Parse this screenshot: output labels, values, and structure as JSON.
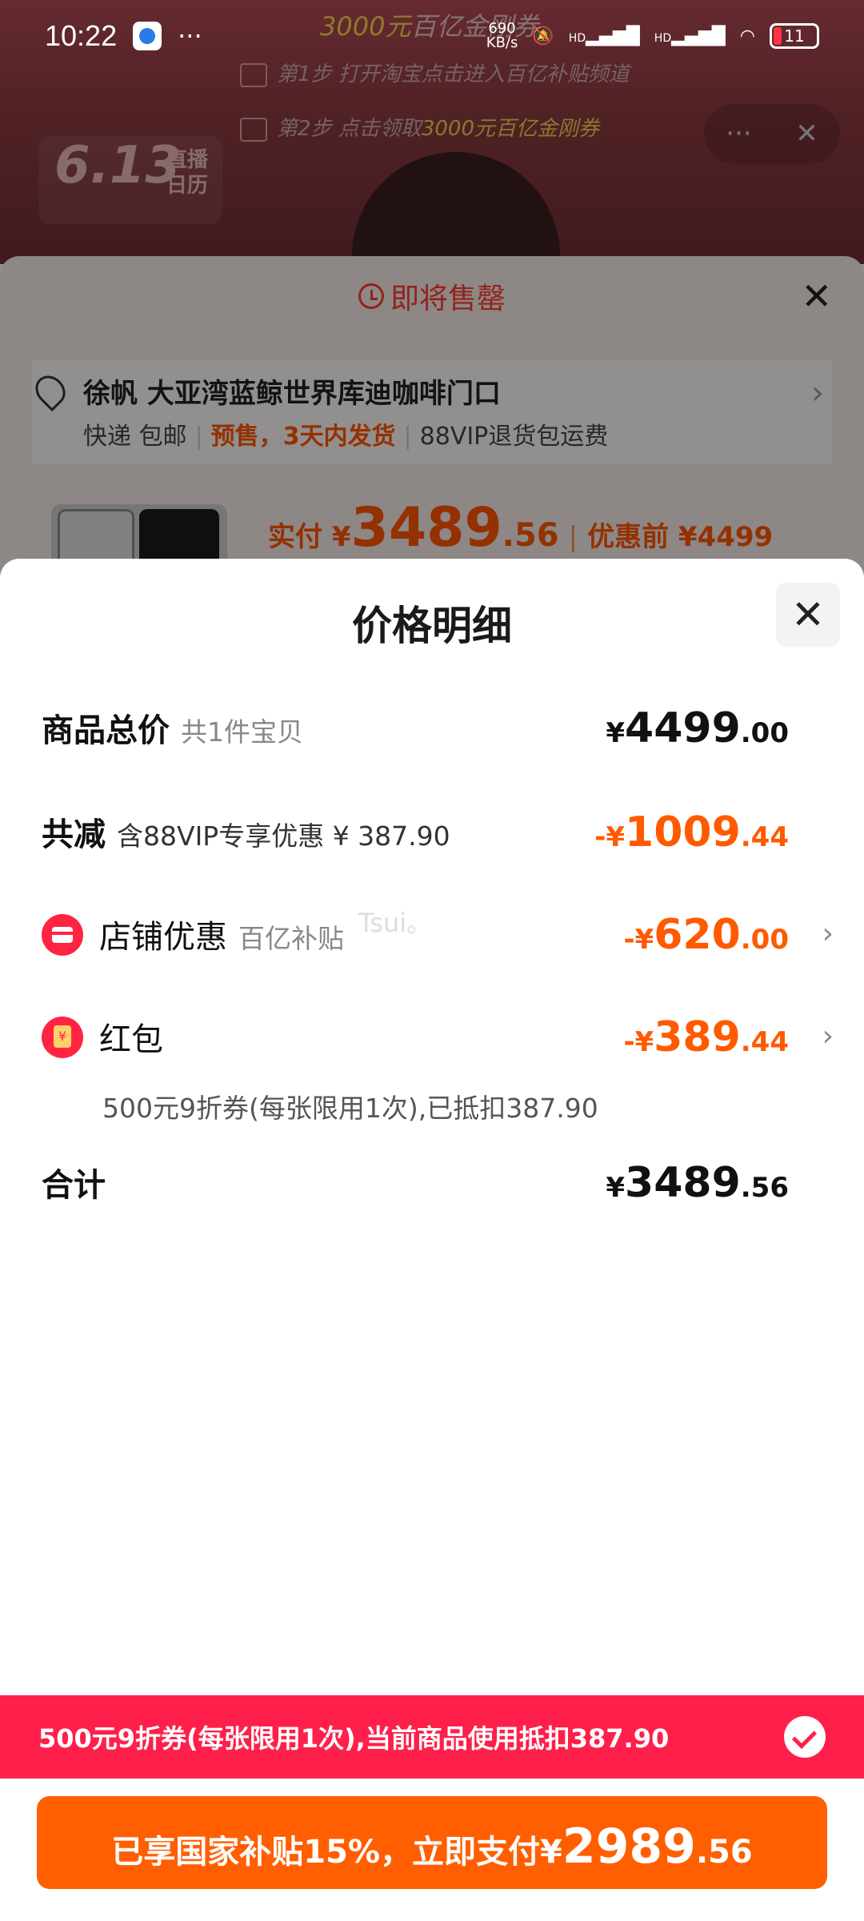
{
  "status_bar": {
    "time": "10:22",
    "dots": "···",
    "speed_value": "690",
    "speed_unit": "KB/s",
    "network": "HD",
    "battery": "11"
  },
  "background": {
    "banner_amount": "3000元",
    "banner_text": "百亿金刚券",
    "step1": "第1步 打开淘宝点击进入百亿补贴频道",
    "step2_prefix": "第2步 点击领取",
    "step2_highlight": "3000元百亿金刚券",
    "date_badge": "6.13",
    "date_badge_sub1": "直播",
    "date_badge_sub2": "日历",
    "pill_more": "···",
    "pill_close": "✕"
  },
  "order_sheet": {
    "title": "即将售罄",
    "close": "✕",
    "address": "徐帆 大亚湾蓝鲸世界库迪咖啡门口",
    "shipping": "快递 包邮",
    "presale": "预售，3天内发货",
    "return_note": "88VIP退货包运费",
    "arrow": "›",
    "pay_label": "实付 ¥",
    "pay_int": "3489",
    "pay_dec": ".56",
    "before_label": "优惠前 ¥4499"
  },
  "price_detail": {
    "title": "价格明细",
    "close": "✕",
    "rows": {
      "total": {
        "label": "商品总价",
        "hint": "共1件宝贝",
        "cur": "¥",
        "int": "4499",
        "dec": ".00"
      },
      "reduced": {
        "label": "共减",
        "hint": "含88VIP专享优惠 ¥ 387.90",
        "cur": "-¥",
        "int": "1009",
        "dec": ".44"
      },
      "shop": {
        "label": "店铺优惠",
        "hint": "百亿补贴",
        "cur": "-¥",
        "int": "620",
        "dec": ".00",
        "chevron": "›"
      },
      "packet": {
        "label": "红包",
        "note": "500元9折券(每张限用1次),已抵扣387.90",
        "cur": "-¥",
        "int": "389",
        "dec": ".44",
        "chevron": "›"
      },
      "sum": {
        "label": "合计",
        "cur": "¥",
        "int": "3489",
        "dec": ".56"
      }
    },
    "watermark": "Tsui。"
  },
  "coupon_strip": {
    "text": "500元9折券(每张限用1次),当前商品使用抵扣387.90"
  },
  "pay_button": {
    "text": "已享国家补贴15%，立即支付",
    "cur": "¥",
    "int": "2989",
    "dec": ".56"
  },
  "colors": {
    "accent_orange": "#ff5f00",
    "accent_red": "#ff1f4b",
    "discount_orange": "#ff5a00"
  }
}
